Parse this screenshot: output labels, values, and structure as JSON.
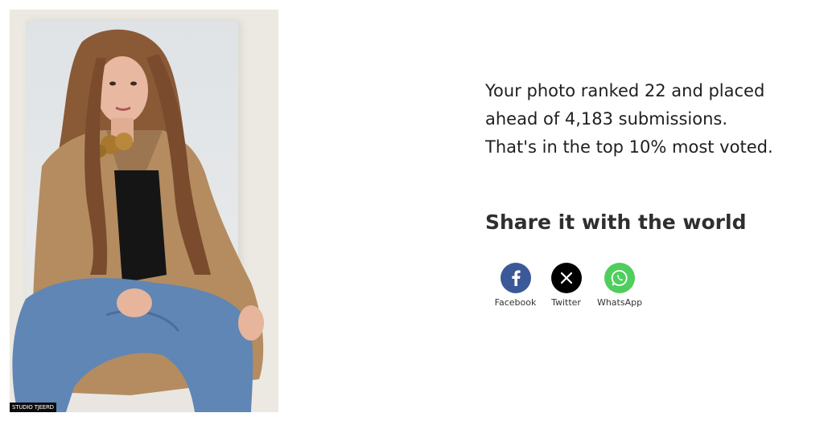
{
  "photo": {
    "credit": "STUDIO TJEERD",
    "alt_icon": "portrait-photo"
  },
  "stats": {
    "line1": "Your photo ranked 22 and placed",
    "line2": "ahead of 4,183 submissions.",
    "line3": "That's in the top 10% most voted."
  },
  "share": {
    "title": "Share it with the world",
    "buttons": [
      {
        "label": "Facebook",
        "icon": "facebook-icon",
        "color": "#3b5998"
      },
      {
        "label": "Twitter",
        "icon": "x-twitter-icon",
        "color": "#000000"
      },
      {
        "label": "WhatsApp",
        "icon": "whatsapp-icon",
        "color": "#4fce5d"
      }
    ]
  }
}
